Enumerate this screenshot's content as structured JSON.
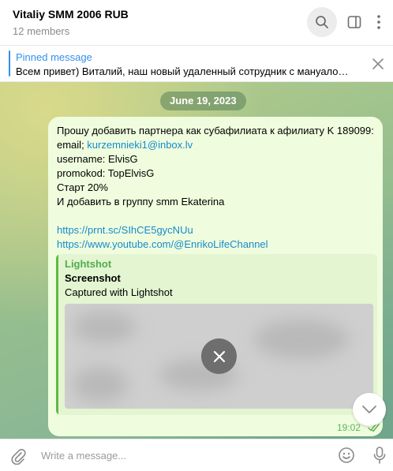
{
  "header": {
    "title": "Vitaliy SMM 2006 RUB",
    "subtitle": "12 members",
    "icons": [
      "search-icon",
      "side-panel-icon",
      "more-icon"
    ]
  },
  "pinned": {
    "title": "Pinned message",
    "text": "Всем привет)  Виталий,  наш новый удаленный сотрудник с мануалом, хочет стать..."
  },
  "chat": {
    "date": "June 19, 2023",
    "message": {
      "lines": [
        "Прошу добавить партнера как субафилиата к афилиату K 189099:",
        "email; ",
        "username:  ElvisG",
        "promokod:  TopElvisG",
        "Старт 20%",
        "И добавить в группу smm Ekaterina"
      ],
      "email": "kurzemnieki1@inbox.lv",
      "links": [
        "https://prnt.sc/SIhCE5gycNUu",
        "https://www.youtube.com/@EnrikoLifeChannel"
      ],
      "time": "19:02"
    },
    "preview": {
      "site": "Lightshot",
      "title": "Screenshot",
      "description": "Captured with Lightshot"
    }
  },
  "composer": {
    "placeholder": "Write a message..."
  },
  "colors": {
    "accent": "#3390ec",
    "bubble": "#effdde",
    "link": "#168acd",
    "preview_accent": "#5fb944"
  }
}
